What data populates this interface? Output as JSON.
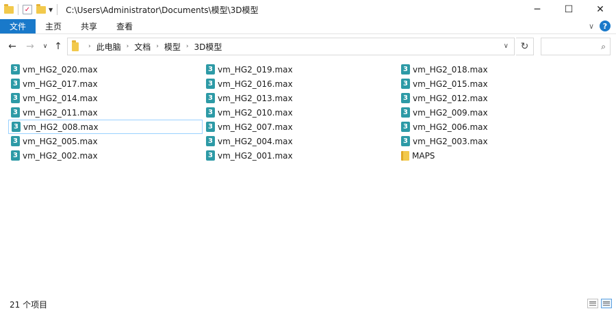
{
  "titlebar": {
    "path": "C:\\Users\\Administrator\\Documents\\模型\\3D模型",
    "minimize": "─",
    "maximize": "☐",
    "close": "✕"
  },
  "ribbon": {
    "tabs": [
      "文件",
      "主页",
      "共享",
      "查看"
    ],
    "collapse": "∨",
    "help": "?"
  },
  "nav": {
    "back": "←",
    "forward": "→",
    "recent": "∨",
    "up": "↑",
    "breadcrumb": [
      "此电脑",
      "文档",
      "模型",
      "3D模型"
    ],
    "crumb_arrow": "›",
    "addr_dropdown": "∨",
    "refresh": "↻",
    "search_icon": "⌕",
    "search_placeholder": ""
  },
  "files": {
    "columns": [
      [
        {
          "name": "vm_HG2_020.max",
          "type": "max"
        },
        {
          "name": "vm_HG2_017.max",
          "type": "max"
        },
        {
          "name": "vm_HG2_014.max",
          "type": "max"
        },
        {
          "name": "vm_HG2_011.max",
          "type": "max"
        },
        {
          "name": "vm_HG2_008.max",
          "type": "max",
          "selected": true
        },
        {
          "name": "vm_HG2_005.max",
          "type": "max"
        },
        {
          "name": "vm_HG2_002.max",
          "type": "max"
        }
      ],
      [
        {
          "name": "vm_HG2_019.max",
          "type": "max"
        },
        {
          "name": "vm_HG2_016.max",
          "type": "max"
        },
        {
          "name": "vm_HG2_013.max",
          "type": "max"
        },
        {
          "name": "vm_HG2_010.max",
          "type": "max"
        },
        {
          "name": "vm_HG2_007.max",
          "type": "max"
        },
        {
          "name": "vm_HG2_004.max",
          "type": "max"
        },
        {
          "name": "vm_HG2_001.max",
          "type": "max"
        }
      ],
      [
        {
          "name": "vm_HG2_018.max",
          "type": "max"
        },
        {
          "name": "vm_HG2_015.max",
          "type": "max"
        },
        {
          "name": "vm_HG2_012.max",
          "type": "max"
        },
        {
          "name": "vm_HG2_009.max",
          "type": "max"
        },
        {
          "name": "vm_HG2_006.max",
          "type": "max"
        },
        {
          "name": "vm_HG2_003.max",
          "type": "max"
        },
        {
          "name": "MAPS",
          "type": "folder"
        }
      ]
    ],
    "max_icon_glyph": "3",
    "icons": {
      "max": "3dsmax-file-icon",
      "folder": "folder-icon"
    }
  },
  "status": {
    "count": "21 个项目"
  },
  "colors": {
    "accent": "#1979ca",
    "selection_border": "#99d1ff",
    "max_icon": "#2d9aa6",
    "folder": "#f2c94c"
  }
}
